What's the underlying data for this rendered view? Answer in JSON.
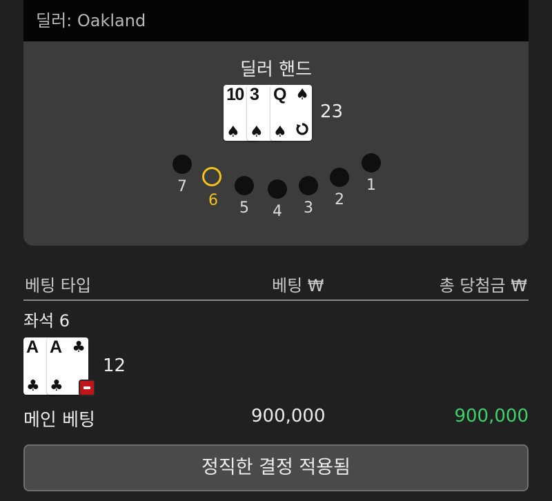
{
  "dealer_label": "딜러: Oakland",
  "dealer_hand": {
    "title": "딜러 핸드",
    "cards": [
      {
        "rank": "10",
        "suit": "♠"
      },
      {
        "rank": "3",
        "suit": "♠"
      },
      {
        "rank": "Q",
        "suit": "♠"
      }
    ],
    "value": "23"
  },
  "seats": [
    {
      "number": "7",
      "active": false
    },
    {
      "number": "6",
      "active": true
    },
    {
      "number": "5",
      "active": false
    },
    {
      "number": "4",
      "active": false
    },
    {
      "number": "3",
      "active": false
    },
    {
      "number": "2",
      "active": false
    },
    {
      "number": "1",
      "active": false
    }
  ],
  "bet_table": {
    "col_type": "베팅 타입",
    "col_bet": "베팅 ₩",
    "col_win": "총 당첨금 ₩"
  },
  "player": {
    "seat_label": "좌석 6",
    "cards": [
      {
        "rank": "A",
        "suit": "♣"
      },
      {
        "rank": "A",
        "suit": "♣"
      }
    ],
    "value": "12"
  },
  "main_bet": {
    "label": "메인 베팅",
    "amount": "900,000",
    "win": "900,000",
    "win_color": "#3ed06a"
  },
  "confirm_button": "정직한 결정 적용됨"
}
